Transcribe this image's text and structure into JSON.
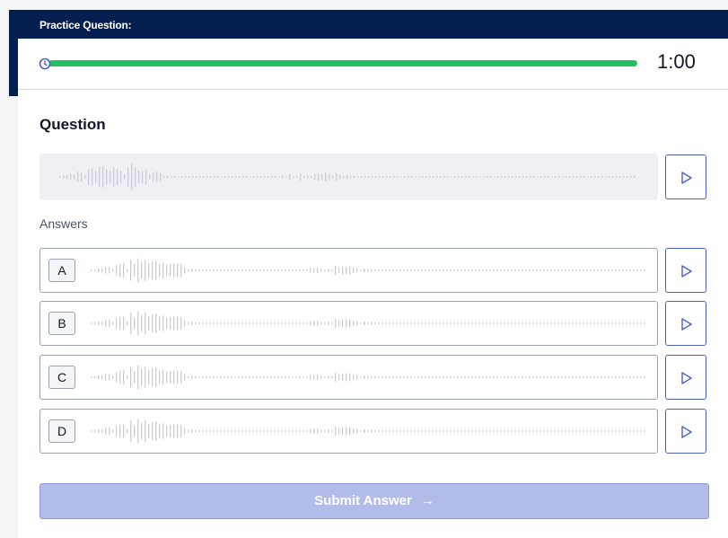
{
  "header": {
    "title": "Practice Question:"
  },
  "timer": {
    "value": "1:00",
    "progress_percent": 100
  },
  "question": {
    "heading": "Question"
  },
  "answers": {
    "label": "Answers",
    "options": [
      {
        "letter": "A"
      },
      {
        "letter": "B"
      },
      {
        "letter": "C"
      },
      {
        "letter": "D"
      }
    ]
  },
  "submit": {
    "label": "Submit Answer",
    "arrow": "→"
  },
  "colors": {
    "header_bg": "#031e4f",
    "progress": "#21bf62",
    "accent": "#4b5fc7",
    "submit_disabled": "#b3bce8"
  },
  "icons": [
    "clock-icon",
    "play-icon",
    "arrow-right-icon",
    "waveform-icon"
  ]
}
